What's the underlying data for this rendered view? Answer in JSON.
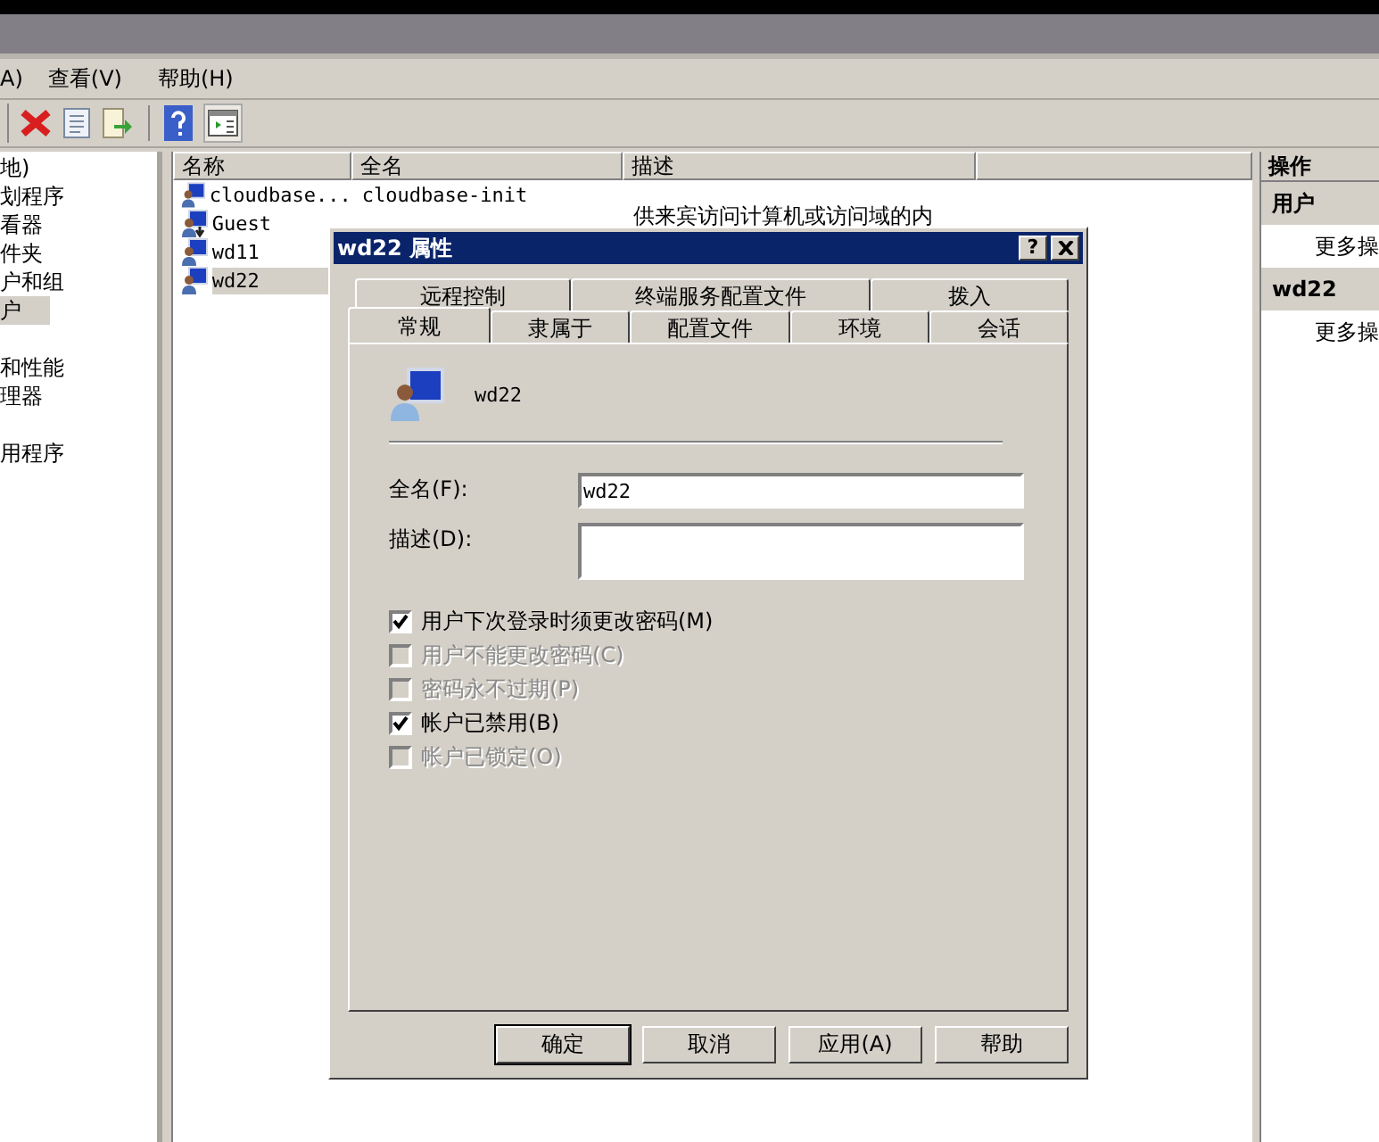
{
  "menu": [
    {
      "label": "A)"
    },
    {
      "label": "查看(V)"
    },
    {
      "label": "帮助(H)"
    }
  ],
  "tree": {
    "items": [
      {
        "label": "地)",
        "selected": false
      },
      {
        "label": "划程序",
        "selected": false
      },
      {
        "label": "看器",
        "selected": false
      },
      {
        "label": "件夹",
        "selected": false
      },
      {
        "label": "户和组",
        "selected": false
      },
      {
        "label": "户",
        "selected": true
      },
      {
        "kind": "gap"
      },
      {
        "label": "和性能",
        "selected": false
      },
      {
        "label": "理器",
        "selected": false
      },
      {
        "kind": "gap"
      },
      {
        "label": "用程序",
        "selected": false
      }
    ]
  },
  "list": {
    "columns": [
      "名称",
      "全名",
      "描述"
    ],
    "rows": [
      {
        "name": "cloudbase...",
        "full_name": "cloudbase-init",
        "kind": "user",
        "selected": false
      },
      {
        "name": "Guest",
        "description": "供来宾访问计算机或访问域的内",
        "kind": "disabled_user",
        "selected": false
      },
      {
        "name": "wd11",
        "kind": "user",
        "selected": false
      },
      {
        "name": "wd22",
        "kind": "user",
        "selected": true
      }
    ]
  },
  "actions": {
    "title": "操作",
    "sections": [
      {
        "heading": "用户",
        "items": [
          "更多操"
        ]
      },
      {
        "heading": "wd22",
        "items": [
          "更多操"
        ]
      }
    ]
  },
  "dialog": {
    "title": "wd22 属性",
    "help": "?",
    "tab_rows": [
      [
        {
          "label": "远程控制",
          "selected": false
        },
        {
          "label": "终端服务配置文件",
          "selected": false
        },
        {
          "label": "拨入",
          "selected": false
        }
      ],
      [
        {
          "label": "常规",
          "selected": true
        },
        {
          "label": "隶属于",
          "selected": false
        },
        {
          "label": "配置文件",
          "selected": false
        },
        {
          "label": "环境",
          "selected": false
        },
        {
          "label": "会话",
          "selected": false
        }
      ]
    ],
    "user_name": "wd22",
    "fields": [
      {
        "label": "全名(F):",
        "value": "wd22",
        "kind": "line"
      },
      {
        "label": "描述(D):",
        "kind": "box"
      }
    ],
    "checkboxes": [
      {
        "label": "用户下次登录时须更改密码(M)",
        "checked": true,
        "disabled": false
      },
      {
        "label": "用户不能更改密码(C)",
        "checked": false,
        "disabled": true
      },
      {
        "label": "密码永不过期(P)",
        "checked": false,
        "disabled": true
      },
      {
        "label": "帐户已禁用(B)",
        "checked": true,
        "disabled": false
      },
      {
        "label": "帐户已锁定(O)",
        "checked": false,
        "disabled": true
      }
    ],
    "buttons": [
      {
        "label": "确定",
        "default": true
      },
      {
        "label": "取消",
        "default": false
      },
      {
        "label": "应用(A)",
        "default": false
      },
      {
        "label": "帮助",
        "default": false
      }
    ]
  }
}
